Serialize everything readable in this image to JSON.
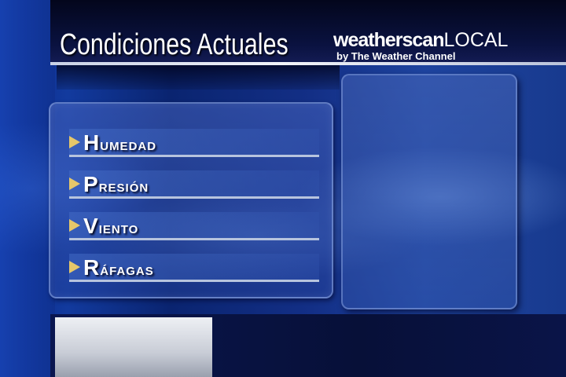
{
  "header": {
    "title": "Condiciones Actuales"
  },
  "logo": {
    "brand_bold": "weatherscan",
    "brand_light": "LOCAL",
    "tagline": "by The Weather Channel"
  },
  "menu": {
    "items": [
      {
        "label": "Humedad"
      },
      {
        "label": "Presión"
      },
      {
        "label": "Viento"
      },
      {
        "label": "Ráfagas"
      }
    ]
  },
  "colors": {
    "arrow": "#e6c76a",
    "rule": "#b7c4de",
    "background": "#123a9e"
  }
}
